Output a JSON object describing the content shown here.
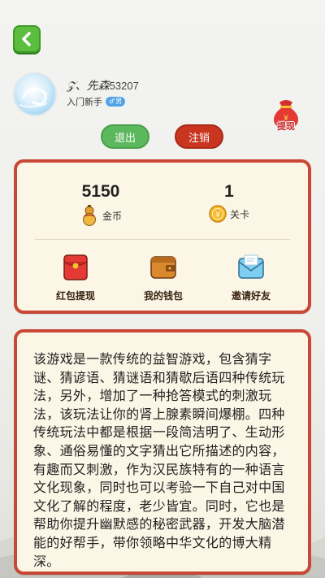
{
  "header": {
    "back_icon": "chevron-left-icon"
  },
  "profile": {
    "name": "𝒵、先森",
    "id": "53207",
    "rank": "入门新手",
    "gender_symbol": "♂",
    "gender_text": "男"
  },
  "withdraw_bag": {
    "label": "提现",
    "icon": "money-bag-icon"
  },
  "buttons": {
    "logout": "退出",
    "cancel_account": "注销"
  },
  "stats": {
    "coins_value": "5150",
    "coins_label": "金币",
    "level_value": "1",
    "level_label": "关卡"
  },
  "actions": [
    {
      "label": "红包提现",
      "icon": "red-envelope-icon"
    },
    {
      "label": "我的钱包",
      "icon": "wallet-icon"
    },
    {
      "label": "邀请好友",
      "icon": "invite-envelope-icon"
    }
  ],
  "description": "该游戏是一款传统的益智游戏，包含猜字谜、猜谚语、猜谜语和猜歇后语四种传统玩法，另外，增加了一种抢答模式的刺激玩法，该玩法让你的肾上腺素瞬间爆棚。四种传统玩法中都是根据一段简洁明了、生动形象、通俗易懂的文字猜出它所描述的内容，有趣而又刺激，作为汉民族特有的一种语言文化现象，同时也可以考验一下自己对中国文化了解的程度，老少皆宜。同时，它也是帮助你提升幽默感的秘密武器，开发大脑潜能的好帮手，带你领略中华文化的博大精深。",
  "colors": {
    "green": "#5cb85c",
    "red": "#c9351e",
    "panel_border": "#c94835",
    "panel_bg": "#fcf6e6"
  }
}
